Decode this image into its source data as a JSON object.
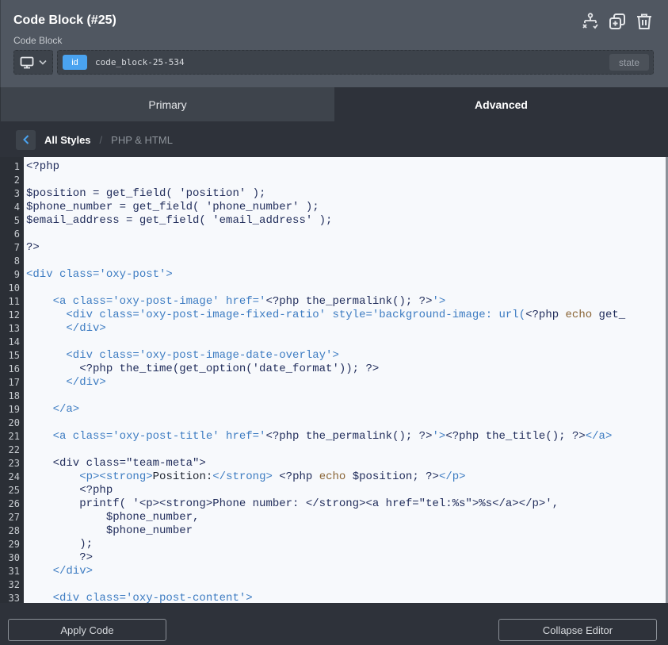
{
  "header": {
    "title": "Code Block (#25)",
    "subtitle": "Code Block",
    "icons": [
      "structure-icon",
      "duplicate-icon",
      "trash-icon"
    ],
    "device_icon": "desktop-icon",
    "id_badge": "id",
    "id_value": "code_block-25-534",
    "state_label": "state"
  },
  "tabs": [
    {
      "label": "Primary",
      "active": false
    },
    {
      "label": "Advanced",
      "active": true
    }
  ],
  "breadcrumb": {
    "root": "All Styles",
    "separator": "/",
    "current": "PHP & HTML"
  },
  "editor": {
    "language": "PHP & HTML",
    "lines": [
      [
        [
          "php",
          "<?php"
        ]
      ],
      [],
      [
        [
          "php",
          "$position = get_field( 'position' );"
        ]
      ],
      [
        [
          "php",
          "$phone_number = get_field( 'phone_number' );"
        ]
      ],
      [
        [
          "php",
          "$email_address = get_field( 'email_address' );"
        ]
      ],
      [],
      [
        [
          "php",
          "?>"
        ]
      ],
      [],
      [
        [
          "tag",
          "<div class='oxy-post'>"
        ]
      ],
      [],
      [
        [
          "tag",
          "    <a class='oxy-post-image' href='"
        ],
        [
          "php",
          "<?php the_permalink(); ?>"
        ],
        [
          "tag",
          "'>"
        ]
      ],
      [
        [
          "tag",
          "      <div class='oxy-post-image-fixed-ratio' style='background-image: url("
        ],
        [
          "php",
          "<?php "
        ],
        [
          "kw",
          "echo"
        ],
        [
          "php",
          " get_"
        ]
      ],
      [
        [
          "tag",
          "      </div>"
        ]
      ],
      [],
      [
        [
          "tag",
          "      <div class='oxy-post-image-date-overlay'>"
        ]
      ],
      [
        [
          "php",
          "        <?php the_time(get_option('date_format')); ?>"
        ]
      ],
      [
        [
          "tag",
          "      </div>"
        ]
      ],
      [],
      [
        [
          "tag",
          "    </a>"
        ]
      ],
      [],
      [
        [
          "tag",
          "    <a class='oxy-post-title' href='"
        ],
        [
          "php",
          "<?php the_permalink(); ?>"
        ],
        [
          "tag",
          "'>"
        ],
        [
          "php",
          "<?php the_title(); ?>"
        ],
        [
          "tag",
          "</a>"
        ]
      ],
      [],
      [
        [
          "php",
          "    <div class=\"team-meta\">"
        ]
      ],
      [
        [
          "tag",
          "        <p><strong>"
        ],
        [
          "txt",
          "Position:"
        ],
        [
          "tag",
          "</strong> "
        ],
        [
          "php",
          "<?php "
        ],
        [
          "kw",
          "echo"
        ],
        [
          "php",
          " $position; ?>"
        ],
        [
          "tag",
          "</p>"
        ]
      ],
      [
        [
          "php",
          "        <?php"
        ]
      ],
      [
        [
          "php",
          "        printf( '<p><strong>Phone number: </strong><a href=\"tel:%s\">%s</a></p>',"
        ]
      ],
      [
        [
          "php",
          "            $phone_number,"
        ]
      ],
      [
        [
          "php",
          "            $phone_number"
        ]
      ],
      [
        [
          "php",
          "        );"
        ]
      ],
      [
        [
          "php",
          "        ?>"
        ]
      ],
      [
        [
          "tag",
          "    </div>"
        ]
      ],
      [],
      [
        [
          "tag",
          "    <div class='oxy-post-content'>"
        ]
      ]
    ]
  },
  "footer": {
    "apply_label": "Apply Code",
    "collapse_label": "Collapse Editor"
  }
}
